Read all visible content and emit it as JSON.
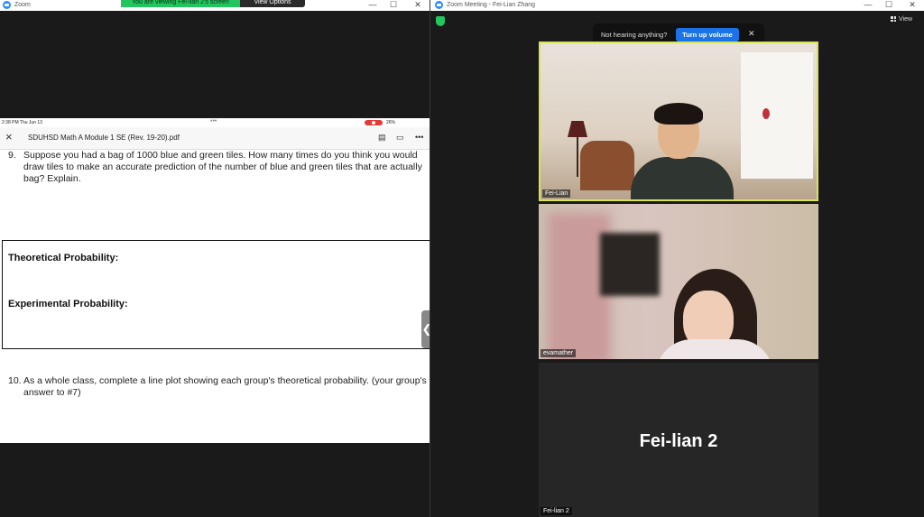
{
  "left_window": {
    "title": "Zoom",
    "viewing_banner": "You are viewing Fei-lian 2's screen",
    "view_options_label": "View Options",
    "controls": {
      "minimize": "—",
      "maximize": "☐",
      "close": "✕"
    }
  },
  "ipad": {
    "status": {
      "time": "2:38 PM  Thu Jun 13",
      "dots": "•••",
      "battery": "26%"
    },
    "doc_title": "SDUHSD Math A Module 1 SE (Rev. 19-20).pdf",
    "content": {
      "q9_number": "9.",
      "q9_text": "Suppose you had a bag of 1000 blue and green tiles. How many times do you think you would\ndraw tiles to make an accurate prediction of the number of blue and green tiles that are actually\nbag? Explain.",
      "theoretical_label": "Theoretical Probability:",
      "experimental_label": "Experimental Probability:",
      "q10_number": "10.",
      "q10_text": "As a whole class, complete a line plot showing each group's theoretical probability. (your group's\nanswer to #7)"
    }
  },
  "right_window": {
    "title": "Zoom Meeting - Fei-Lian Zhang",
    "controls": {
      "minimize": "—",
      "maximize": "☐",
      "close": "✕"
    },
    "view_label": "View",
    "toast": {
      "text": "Not hearing anything?",
      "button": "Turn up volume",
      "close": "✕"
    },
    "participants": [
      {
        "name": "Fei-Lian"
      },
      {
        "name": "evamather"
      },
      {
        "name": "Fei-lian 2",
        "display_name": "Fei-lian 2"
      }
    ]
  }
}
